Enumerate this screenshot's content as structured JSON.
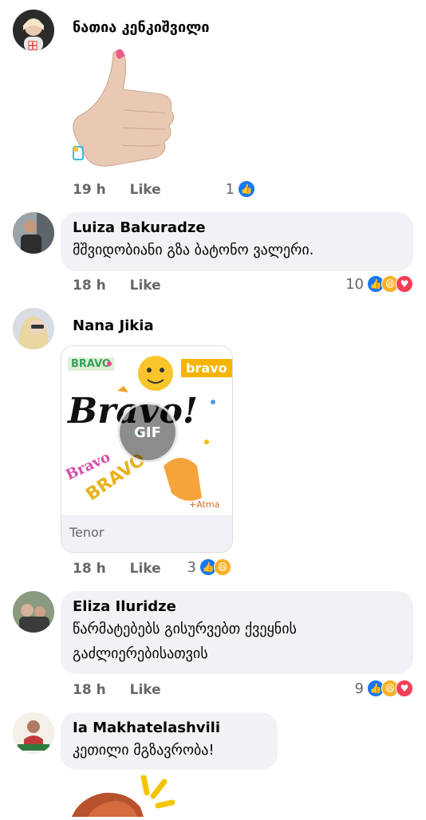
{
  "comments": [
    {
      "author": "ნათია კენკიშვილი",
      "time": "19 h",
      "like_label": "Like",
      "reaction_count": "1"
    },
    {
      "author": "Luiza Bakuradze",
      "text": "მშვიდობიანი გზა ბატონო ვალერი.",
      "time": "18 h",
      "like_label": "Like",
      "reaction_count": "10"
    },
    {
      "author": "Nana Jikia",
      "gif_badge": "GIF",
      "gif_source": "Tenor",
      "gif_words": [
        "Bravo!",
        "BRAVO",
        "Bravo",
        "bravo",
        "BRAVO",
        "+Atma"
      ],
      "time": "18 h",
      "like_label": "Like",
      "reaction_count": "3"
    },
    {
      "author": "Eliza Iluridze",
      "text_line1": "წარმატებებს გისურვებთ ქვეყნის",
      "text_line2": "გაძლიერებისათვის",
      "time": "18 h",
      "like_label": "Like",
      "reaction_count": "9"
    },
    {
      "author": "Ia Makhatelashvili",
      "text": "კეთილი მგზავრობა!"
    }
  ]
}
